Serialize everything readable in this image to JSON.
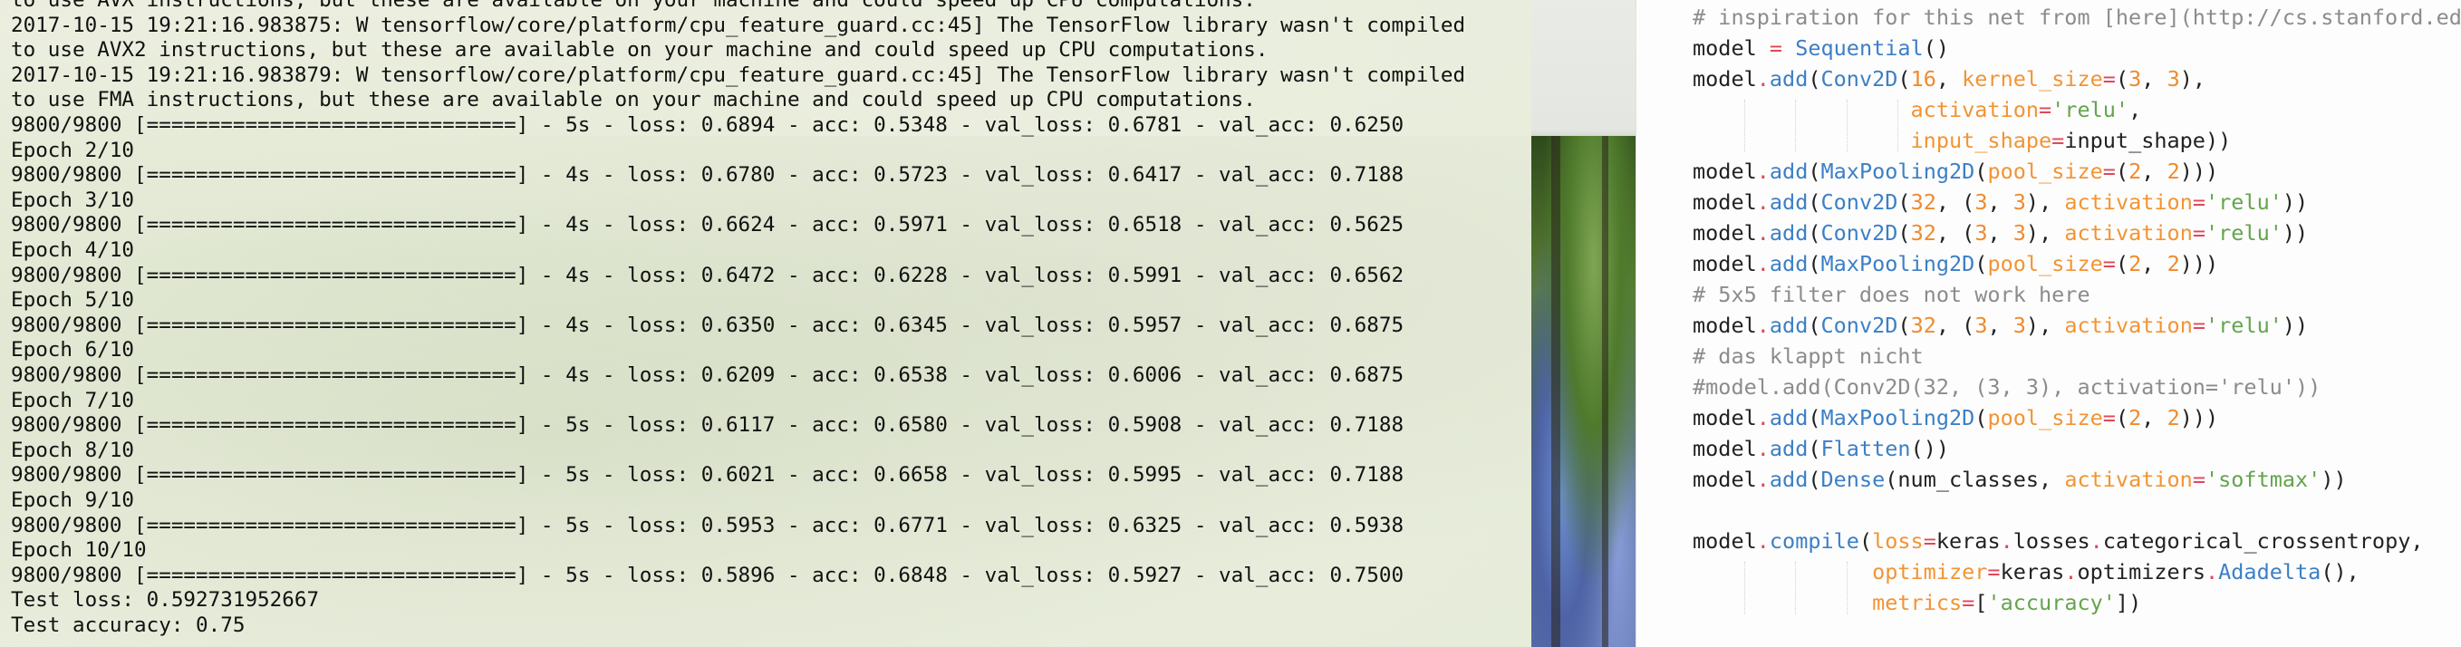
{
  "terminal": {
    "lines": [
      "to use AVX instructions, but these are available on your machine and could speed up CPU computations.",
      "2017-10-15 19:21:16.983875: W tensorflow/core/platform/cpu_feature_guard.cc:45] The TensorFlow library wasn't compiled",
      "to use AVX2 instructions, but these are available on your machine and could speed up CPU computations.",
      "2017-10-15 19:21:16.983879: W tensorflow/core/platform/cpu_feature_guard.cc:45] The TensorFlow library wasn't compiled",
      "to use FMA instructions, but these are available on your machine and could speed up CPU computations.",
      "9800/9800 [==============================] - 5s - loss: 0.6894 - acc: 0.5348 - val_loss: 0.6781 - val_acc: 0.6250",
      "Epoch 2/10",
      "9800/9800 [==============================] - 4s - loss: 0.6780 - acc: 0.5723 - val_loss: 0.6417 - val_acc: 0.7188",
      "Epoch 3/10",
      "9800/9800 [==============================] - 4s - loss: 0.6624 - acc: 0.5971 - val_loss: 0.6518 - val_acc: 0.5625",
      "Epoch 4/10",
      "9800/9800 [==============================] - 4s - loss: 0.6472 - acc: 0.6228 - val_loss: 0.5991 - val_acc: 0.6562",
      "Epoch 5/10",
      "9800/9800 [==============================] - 4s - loss: 0.6350 - acc: 0.6345 - val_loss: 0.5957 - val_acc: 0.6875",
      "Epoch 6/10",
      "9800/9800 [==============================] - 4s - loss: 0.6209 - acc: 0.6538 - val_loss: 0.6006 - val_acc: 0.6875",
      "Epoch 7/10",
      "9800/9800 [==============================] - 5s - loss: 0.6117 - acc: 0.6580 - val_loss: 0.5908 - val_acc: 0.7188",
      "Epoch 8/10",
      "9800/9800 [==============================] - 5s - loss: 0.6021 - acc: 0.6658 - val_loss: 0.5995 - val_acc: 0.7188",
      "Epoch 9/10",
      "9800/9800 [==============================] - 5s - loss: 0.5953 - acc: 0.6771 - val_loss: 0.6325 - val_acc: 0.5938",
      "Epoch 10/10",
      "9800/9800 [==============================] - 5s - loss: 0.5896 - acc: 0.6848 - val_loss: 0.5927 - val_acc: 0.7500",
      "Test loss: 0.592731952667",
      "Test accuracy: 0.75"
    ]
  },
  "editor": {
    "code": [
      [
        {
          "t": "# inspiration for this net from [here](http://cs.stanford.edu",
          "c": "comment"
        }
      ],
      [
        {
          "t": "model ",
          "c": "plain"
        },
        {
          "t": "=",
          "c": "op"
        },
        {
          "t": " ",
          "c": "plain"
        },
        {
          "t": "Sequential",
          "c": "class"
        },
        {
          "t": "()",
          "c": "plain"
        }
      ],
      [
        {
          "t": "model",
          "c": "plain"
        },
        {
          "t": ".",
          "c": "op"
        },
        {
          "t": "add",
          "c": "class"
        },
        {
          "t": "(",
          "c": "plain"
        },
        {
          "t": "Conv2D",
          "c": "class"
        },
        {
          "t": "(",
          "c": "plain"
        },
        {
          "t": "16",
          "c": "num"
        },
        {
          "t": ", ",
          "c": "plain"
        },
        {
          "t": "kernel_size",
          "c": "kw"
        },
        {
          "t": "=",
          "c": "op"
        },
        {
          "t": "(",
          "c": "plain"
        },
        {
          "t": "3",
          "c": "num"
        },
        {
          "t": ", ",
          "c": "plain"
        },
        {
          "t": "3",
          "c": "num"
        },
        {
          "t": "),",
          "c": "plain"
        }
      ],
      [
        {
          "t": "                 ",
          "c": "plain"
        },
        {
          "t": "activation",
          "c": "kw"
        },
        {
          "t": "=",
          "c": "op"
        },
        {
          "t": "'relu'",
          "c": "str"
        },
        {
          "t": ",",
          "c": "plain"
        }
      ],
      [
        {
          "t": "                 ",
          "c": "plain"
        },
        {
          "t": "input_shape",
          "c": "kw"
        },
        {
          "t": "=",
          "c": "op"
        },
        {
          "t": "input_shape))",
          "c": "plain"
        }
      ],
      [
        {
          "t": "model",
          "c": "plain"
        },
        {
          "t": ".",
          "c": "op"
        },
        {
          "t": "add",
          "c": "class"
        },
        {
          "t": "(",
          "c": "plain"
        },
        {
          "t": "MaxPooling2D",
          "c": "class"
        },
        {
          "t": "(",
          "c": "plain"
        },
        {
          "t": "pool_size",
          "c": "kw"
        },
        {
          "t": "=",
          "c": "op"
        },
        {
          "t": "(",
          "c": "plain"
        },
        {
          "t": "2",
          "c": "num"
        },
        {
          "t": ", ",
          "c": "plain"
        },
        {
          "t": "2",
          "c": "num"
        },
        {
          "t": ")))",
          "c": "plain"
        }
      ],
      [
        {
          "t": "model",
          "c": "plain"
        },
        {
          "t": ".",
          "c": "op"
        },
        {
          "t": "add",
          "c": "class"
        },
        {
          "t": "(",
          "c": "plain"
        },
        {
          "t": "Conv2D",
          "c": "class"
        },
        {
          "t": "(",
          "c": "plain"
        },
        {
          "t": "32",
          "c": "num"
        },
        {
          "t": ", (",
          "c": "plain"
        },
        {
          "t": "3",
          "c": "num"
        },
        {
          "t": ", ",
          "c": "plain"
        },
        {
          "t": "3",
          "c": "num"
        },
        {
          "t": "), ",
          "c": "plain"
        },
        {
          "t": "activation",
          "c": "kw"
        },
        {
          "t": "=",
          "c": "op"
        },
        {
          "t": "'relu'",
          "c": "str"
        },
        {
          "t": "))",
          "c": "plain"
        }
      ],
      [
        {
          "t": "model",
          "c": "plain"
        },
        {
          "t": ".",
          "c": "op"
        },
        {
          "t": "add",
          "c": "class"
        },
        {
          "t": "(",
          "c": "plain"
        },
        {
          "t": "Conv2D",
          "c": "class"
        },
        {
          "t": "(",
          "c": "plain"
        },
        {
          "t": "32",
          "c": "num"
        },
        {
          "t": ", (",
          "c": "plain"
        },
        {
          "t": "3",
          "c": "num"
        },
        {
          "t": ", ",
          "c": "plain"
        },
        {
          "t": "3",
          "c": "num"
        },
        {
          "t": "), ",
          "c": "plain"
        },
        {
          "t": "activation",
          "c": "kw"
        },
        {
          "t": "=",
          "c": "op"
        },
        {
          "t": "'relu'",
          "c": "str"
        },
        {
          "t": "))",
          "c": "plain"
        }
      ],
      [
        {
          "t": "model",
          "c": "plain"
        },
        {
          "t": ".",
          "c": "op"
        },
        {
          "t": "add",
          "c": "class"
        },
        {
          "t": "(",
          "c": "plain"
        },
        {
          "t": "MaxPooling2D",
          "c": "class"
        },
        {
          "t": "(",
          "c": "plain"
        },
        {
          "t": "pool_size",
          "c": "kw"
        },
        {
          "t": "=",
          "c": "op"
        },
        {
          "t": "(",
          "c": "plain"
        },
        {
          "t": "2",
          "c": "num"
        },
        {
          "t": ", ",
          "c": "plain"
        },
        {
          "t": "2",
          "c": "num"
        },
        {
          "t": ")))",
          "c": "plain"
        }
      ],
      [
        {
          "t": "# 5x5 filter does not work here",
          "c": "comment"
        }
      ],
      [
        {
          "t": "model",
          "c": "plain"
        },
        {
          "t": ".",
          "c": "op"
        },
        {
          "t": "add",
          "c": "class"
        },
        {
          "t": "(",
          "c": "plain"
        },
        {
          "t": "Conv2D",
          "c": "class"
        },
        {
          "t": "(",
          "c": "plain"
        },
        {
          "t": "32",
          "c": "num"
        },
        {
          "t": ", (",
          "c": "plain"
        },
        {
          "t": "3",
          "c": "num"
        },
        {
          "t": ", ",
          "c": "plain"
        },
        {
          "t": "3",
          "c": "num"
        },
        {
          "t": "), ",
          "c": "plain"
        },
        {
          "t": "activation",
          "c": "kw"
        },
        {
          "t": "=",
          "c": "op"
        },
        {
          "t": "'relu'",
          "c": "str"
        },
        {
          "t": "))",
          "c": "plain"
        }
      ],
      [
        {
          "t": "# das klappt nicht",
          "c": "comment"
        }
      ],
      [
        {
          "t": "#model.add(Conv2D(32, (3, 3), activation='relu'))",
          "c": "comment"
        }
      ],
      [
        {
          "t": "model",
          "c": "plain"
        },
        {
          "t": ".",
          "c": "op"
        },
        {
          "t": "add",
          "c": "class"
        },
        {
          "t": "(",
          "c": "plain"
        },
        {
          "t": "MaxPooling2D",
          "c": "class"
        },
        {
          "t": "(",
          "c": "plain"
        },
        {
          "t": "pool_size",
          "c": "kw"
        },
        {
          "t": "=",
          "c": "op"
        },
        {
          "t": "(",
          "c": "plain"
        },
        {
          "t": "2",
          "c": "num"
        },
        {
          "t": ", ",
          "c": "plain"
        },
        {
          "t": "2",
          "c": "num"
        },
        {
          "t": ")))",
          "c": "plain"
        }
      ],
      [
        {
          "t": "model",
          "c": "plain"
        },
        {
          "t": ".",
          "c": "op"
        },
        {
          "t": "add",
          "c": "class"
        },
        {
          "t": "(",
          "c": "plain"
        },
        {
          "t": "Flatten",
          "c": "class"
        },
        {
          "t": "())",
          "c": "plain"
        }
      ],
      [
        {
          "t": "model",
          "c": "plain"
        },
        {
          "t": ".",
          "c": "op"
        },
        {
          "t": "add",
          "c": "class"
        },
        {
          "t": "(",
          "c": "plain"
        },
        {
          "t": "Dense",
          "c": "class"
        },
        {
          "t": "(num_classes, ",
          "c": "plain"
        },
        {
          "t": "activation",
          "c": "kw"
        },
        {
          "t": "=",
          "c": "op"
        },
        {
          "t": "'softmax'",
          "c": "str"
        },
        {
          "t": "))",
          "c": "plain"
        }
      ],
      [
        {
          "t": "",
          "c": "plain"
        }
      ],
      [
        {
          "t": "model",
          "c": "plain"
        },
        {
          "t": ".",
          "c": "op"
        },
        {
          "t": "compile",
          "c": "class"
        },
        {
          "t": "(",
          "c": "plain"
        },
        {
          "t": "loss",
          "c": "kw"
        },
        {
          "t": "=",
          "c": "op"
        },
        {
          "t": "keras",
          "c": "plain"
        },
        {
          "t": ".",
          "c": "op"
        },
        {
          "t": "losses",
          "c": "plain"
        },
        {
          "t": ".",
          "c": "op"
        },
        {
          "t": "categorical_crossentropy",
          "c": "plain"
        },
        {
          "t": ",",
          "c": "plain"
        }
      ],
      [
        {
          "t": "              ",
          "c": "plain"
        },
        {
          "t": "optimizer",
          "c": "kw"
        },
        {
          "t": "=",
          "c": "op"
        },
        {
          "t": "keras",
          "c": "plain"
        },
        {
          "t": ".",
          "c": "op"
        },
        {
          "t": "optimizers",
          "c": "plain"
        },
        {
          "t": ".",
          "c": "op"
        },
        {
          "t": "Adadelta",
          "c": "class"
        },
        {
          "t": "(),",
          "c": "plain"
        }
      ],
      [
        {
          "t": "              ",
          "c": "plain"
        },
        {
          "t": "metrics",
          "c": "kw"
        },
        {
          "t": "=",
          "c": "op"
        },
        {
          "t": "[",
          "c": "plain"
        },
        {
          "t": "'accuracy'",
          "c": "str"
        },
        {
          "t": "])",
          "c": "plain"
        }
      ]
    ]
  },
  "colors": {
    "comment": "#8c8c8c",
    "class": "#3c7fc6",
    "op": "#e0475b",
    "num": "#ef8a2e",
    "kw": "#f29434",
    "str": "#64a44d",
    "plain": "#222222"
  }
}
